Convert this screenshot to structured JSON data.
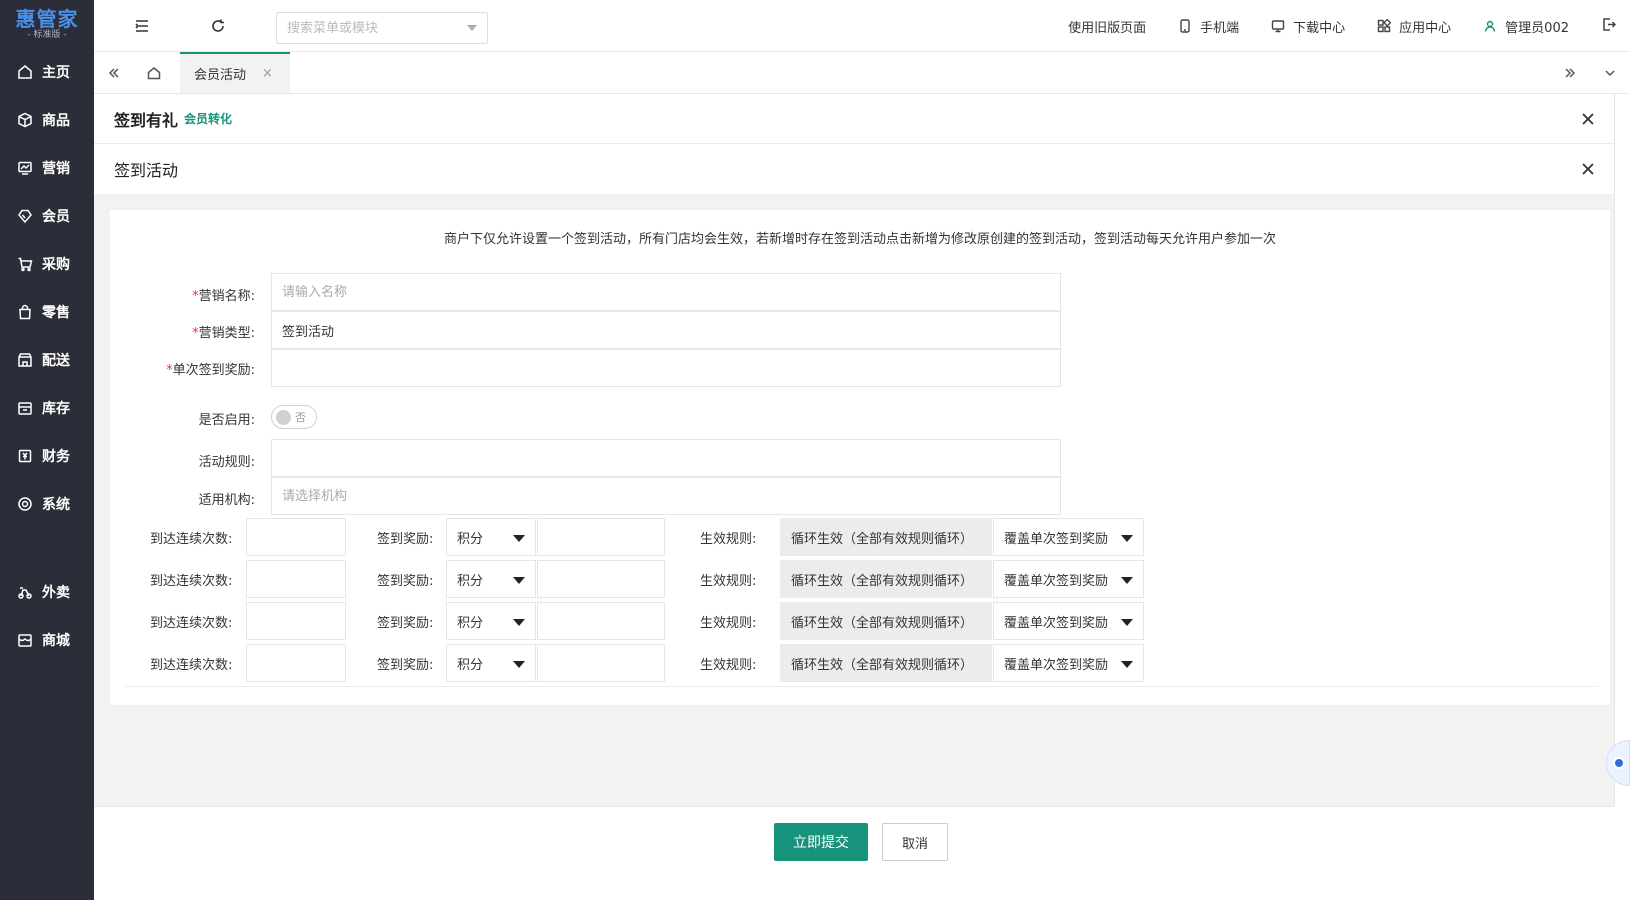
{
  "sidebar": {
    "logo_main": "惠管家",
    "logo_sub": "- 标准版 -",
    "items": [
      {
        "label": "主页",
        "icon": "home-icon"
      },
      {
        "label": "商品",
        "icon": "box-icon"
      },
      {
        "label": "营销",
        "icon": "chart-icon"
      },
      {
        "label": "会员",
        "icon": "diamond-icon"
      },
      {
        "label": "采购",
        "icon": "cart-icon"
      },
      {
        "label": "零售",
        "icon": "bag-icon"
      },
      {
        "label": "配送",
        "icon": "store-icon"
      },
      {
        "label": "库存",
        "icon": "inventory-icon"
      },
      {
        "label": "财务",
        "icon": "finance-icon"
      },
      {
        "label": "系统",
        "icon": "settings-icon"
      }
    ],
    "extra_items": [
      {
        "label": "外卖",
        "icon": "delivery-icon"
      },
      {
        "label": "商城",
        "icon": "mall-icon"
      }
    ]
  },
  "topbar": {
    "search_placeholder": "搜索菜单或模块",
    "links": [
      {
        "label": "使用旧版页面"
      },
      {
        "label": "手机端",
        "icon": "phone-icon"
      },
      {
        "label": "下载中心",
        "icon": "monitor-icon"
      },
      {
        "label": "应用中心",
        "icon": "apps-icon"
      },
      {
        "label": "管理员002",
        "icon": "user-icon"
      }
    ]
  },
  "tabs": {
    "active": "会员活动",
    "close": "×"
  },
  "panels": {
    "header1_title": "签到有礼",
    "header1_sub": "会员转化",
    "header2_title": "签到活动"
  },
  "form": {
    "notice": "商户下仅允许设置一个签到活动，所有门店均会生效，若新增时存在签到活动点击新增为修改原创建的签到活动，签到活动每天允许用户参加一次",
    "name_label": "营销名称:",
    "name_placeholder": "请输入名称",
    "type_label": "营销类型:",
    "type_value": "签到活动",
    "reward_label": "单次签到奖励:",
    "enabled_label": "是否启用:",
    "enabled_state": "否",
    "rules_label": "活动规则:",
    "org_label": "适用机构:",
    "org_placeholder": "请选择机构",
    "required_mark": "*"
  },
  "rules": {
    "count_label": "到达连续次数:",
    "reward_label": "签到奖励:",
    "effect_label": "生效规则:",
    "rows": [
      {
        "reward_type": "积分",
        "cycle": "循环生效（全部有效规则循环）",
        "override": "覆盖单次签到奖励"
      },
      {
        "reward_type": "积分",
        "cycle": "循环生效（全部有效规则循环）",
        "override": "覆盖单次签到奖励"
      },
      {
        "reward_type": "积分",
        "cycle": "循环生效（全部有效规则循环）",
        "override": "覆盖单次签到奖励"
      },
      {
        "reward_type": "积分",
        "cycle": "循环生效（全部有效规则循环）",
        "override": "覆盖单次签到奖励"
      }
    ]
  },
  "footer": {
    "submit_label": "立即提交",
    "cancel_label": "取消"
  },
  "colors": {
    "sidebar_bg": "#2b2e38",
    "accent": "#16937a",
    "logo_blue": "#4a8fe8"
  }
}
